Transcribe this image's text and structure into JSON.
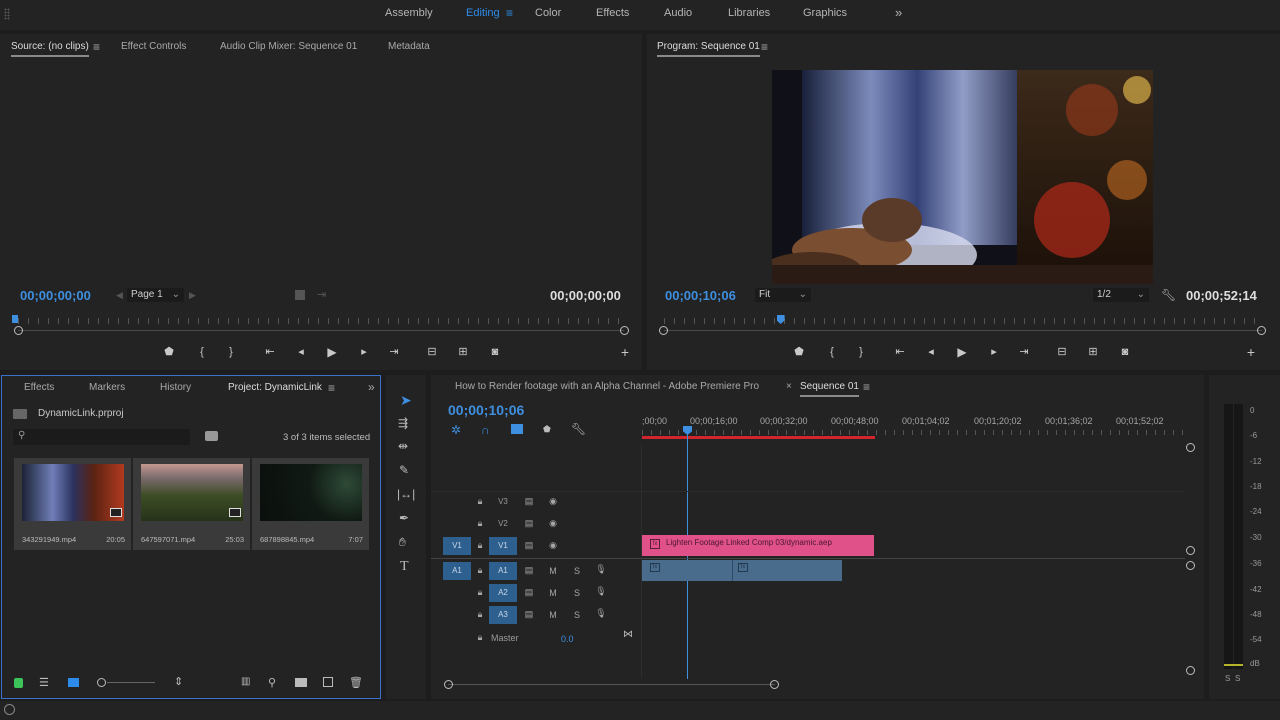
{
  "workspaces": [
    "Assembly",
    "Editing",
    "Color",
    "Effects",
    "Audio",
    "Libraries",
    "Graphics"
  ],
  "workspace_overflow": "»",
  "source": {
    "tabs": [
      "Source: (no clips)",
      "Effect Controls",
      "Audio Clip Mixer: Sequence 01",
      "Metadata"
    ],
    "timecode_left": "00;00;00;00",
    "page": "Page 1",
    "timecode_right": "00;00;00;00"
  },
  "program": {
    "title": "Program: Sequence 01",
    "timecode_left": "00;00;10;06",
    "fit": "Fit",
    "resolution": "1/2",
    "timecode_right": "00;00;52;14",
    "playhead_fraction": 0.195
  },
  "project": {
    "tabs": [
      "Effects",
      "Markers",
      "History",
      "Project: DynamicLink"
    ],
    "file": "DynamicLink.prproj",
    "selection": "3 of 3 items selected",
    "items": [
      {
        "name": "343291949.mp4",
        "duration": "20:05"
      },
      {
        "name": "647597071.mp4",
        "duration": "25:03"
      },
      {
        "name": "687898845.mp4",
        "duration": "7:07"
      }
    ]
  },
  "timeline": {
    "tabs": [
      "How to Render footage with an Alpha Channel - Adobe Premiere Pro",
      "Sequence 01"
    ],
    "timecode": "00;00;10;06",
    "ruler": [
      ";00;00",
      "00;00;16;00",
      "00;00;32;00",
      "00;00;48;00",
      "00;01;04;02",
      "00;01;20;02",
      "00;01;36;02",
      "00;01;52;02"
    ],
    "video_tracks": [
      "V3",
      "V2",
      "V1"
    ],
    "audio_tracks": [
      "A1",
      "A2",
      "A3"
    ],
    "source_v": "V1",
    "source_a": "A1",
    "m_label": "M",
    "s_label": "S",
    "master_label": "Master",
    "master_value": "0.0",
    "clip_label": "Lighten Footage Linked Comp 03/dynamic.aep",
    "fx": "fx"
  },
  "meter": {
    "scale": [
      "0",
      "-6",
      "-12",
      "-18",
      "-24",
      "-30",
      "-36",
      "-42",
      "-48",
      "-54",
      "dB"
    ],
    "solo": [
      "S",
      "S"
    ]
  },
  "colors": {
    "accent": "#2d8ceb",
    "clip": "#e0518a",
    "audio_clip": "#4a6c8c",
    "work_area": "#d2242b",
    "selected_track": "#2d5f8f"
  }
}
